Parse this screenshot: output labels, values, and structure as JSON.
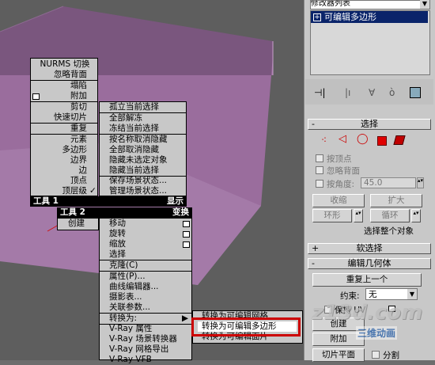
{
  "modifier_list_label": "修改器列表",
  "modifier_stack_item": "可编辑多边形",
  "selection": {
    "rollout_title": "选择",
    "by_vertex": "按顶点",
    "ignore_backfacing": "忽略背面",
    "by_angle": "按角度:",
    "angle_value": "45.0",
    "shrink": "收缩",
    "grow": "扩大",
    "ring": "环形",
    "loop": "循环",
    "status": "选择整个对象"
  },
  "soft_selection_title": "软选择",
  "edit_geometry": {
    "title": "编辑几何体",
    "repeat_last": "重复上一个",
    "constraints_label": "约束:",
    "constraints_value": "无",
    "preserve_uvs": "保持 UV",
    "create": "创建",
    "attach": "附加",
    "slice_plane": "切片平面",
    "split": "分割"
  },
  "quad_left": {
    "items": [
      "NURMS 切换",
      "忽略背面",
      "塌陷",
      "附加",
      "剪切",
      "快速切片",
      "重复",
      "元素",
      "多边形",
      "边界",
      "边",
      "顶点",
      "顶层级"
    ],
    "checked_item": "顶层级",
    "tools1": "工具 1",
    "tools2": "工具 2",
    "create": "创建"
  },
  "quad_right": {
    "items": [
      "孤立当前选择",
      "全部解冻",
      "冻结当前选择",
      "按名称取消隐藏",
      "全部取消隐藏",
      "隐藏未选定对象",
      "隐藏当前选择",
      "保存场景状态...",
      "管理场景状态..."
    ],
    "header": "显示"
  },
  "quad_transform": {
    "header": "变换",
    "items": [
      "移动",
      "旋转",
      "缩放",
      "选择",
      "克隆(C)",
      "属性(P)...",
      "曲线编辑器...",
      "摄影表...",
      "关联参数...",
      "转换为:",
      "V-Ray 属性",
      "V-Ray 场景转换器",
      "V-Ray 网格导出",
      "V-Ray VFB"
    ]
  },
  "submenu": {
    "items": [
      "转换为可编辑网格",
      "转换为可编辑多边形",
      "转换为可编辑面片"
    ],
    "highlighted": "转换为可编辑多边形"
  },
  "watermark": {
    "brand": "z13d.com",
    "sub": "三维动画"
  },
  "colors": {
    "viewport_bg": "#5e5e5e",
    "purple_box": "#a074a4",
    "highlight": "#cc0000"
  }
}
